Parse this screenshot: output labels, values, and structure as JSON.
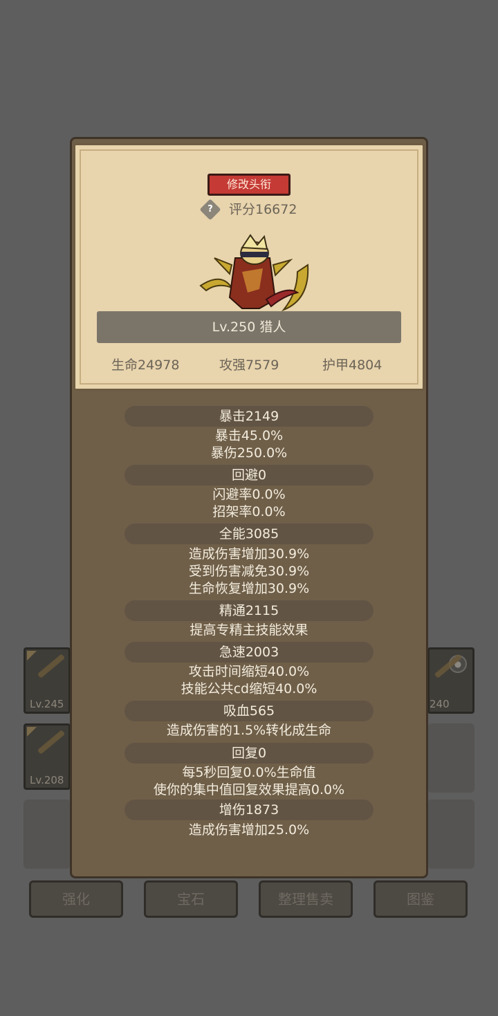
{
  "background": {
    "slots": [
      {
        "level": "Lv.245"
      },
      {
        "level": "Lv.208"
      },
      {
        "level": "240"
      }
    ],
    "bottom_buttons": [
      "强化",
      "宝石",
      "整理售卖",
      "图鉴"
    ]
  },
  "panel": {
    "rename_label": "修改头衔",
    "score_label": "评分16672",
    "name_level": "Lv.250 猎人",
    "stats": {
      "hp": "生命24978",
      "attack": "攻强7579",
      "armor": "护甲4804"
    }
  },
  "attributes": [
    {
      "header": "暴击2149",
      "lines": [
        "暴击45.0%",
        "暴伤250.0%"
      ]
    },
    {
      "header": "回避0",
      "lines": [
        "闪避率0.0%",
        "招架率0.0%"
      ]
    },
    {
      "header": "全能3085",
      "lines": [
        "造成伤害增加30.9%",
        "受到伤害减免30.9%",
        "生命恢复增加30.9%"
      ]
    },
    {
      "header": "精通2115",
      "lines": [
        "提高专精主技能效果"
      ]
    },
    {
      "header": "急速2003",
      "lines": [
        "攻击时间缩短40.0%",
        "技能公共cd缩短40.0%"
      ]
    },
    {
      "header": "吸血565",
      "lines": [
        "造成伤害的1.5%转化成生命"
      ]
    },
    {
      "header": "回复0",
      "lines": [
        "每5秒回复0.0%生命值",
        "使你的集中值回复效果提高0.0%"
      ]
    },
    {
      "header": "增伤1873",
      "lines": [
        "造成伤害增加25.0%"
      ]
    }
  ],
  "icons": {
    "help": "question-diamond-icon",
    "lock": "lock-icon",
    "character": "hunter-character-sprite"
  },
  "colors": {
    "rename_button": "#c53a35",
    "panel": "#e8d4ad",
    "dialog": "#6f5f49"
  }
}
